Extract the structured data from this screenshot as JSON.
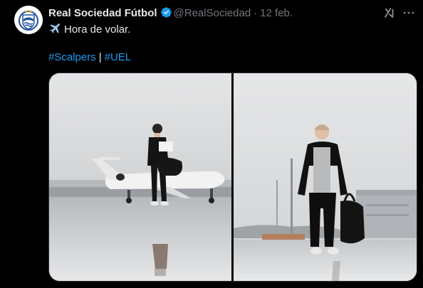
{
  "author": {
    "name": "Real Sociedad Fútbol",
    "handle": "@RealSociedad",
    "separator": "·",
    "date": "12 feb."
  },
  "icons": {
    "avatar": "real-sociedad-crest",
    "verified": "verified-badge-icon",
    "grok": "grok-icon",
    "more": "more-options-icon",
    "plane": "airplane-emoji"
  },
  "tweet": {
    "text": "Hora de volar.",
    "hashtags": [
      "#Scalpers",
      "#UEL"
    ],
    "hashtag_separator": "|"
  },
  "media": {
    "count": 2,
    "items": [
      {
        "subject": "player-with-plane"
      },
      {
        "subject": "player-at-hangar"
      }
    ]
  },
  "colors": {
    "background": "#000000",
    "text": "#e7e9ea",
    "secondary": "#71767b",
    "link": "#1d9bf0",
    "verified": "#1d9bf0"
  }
}
